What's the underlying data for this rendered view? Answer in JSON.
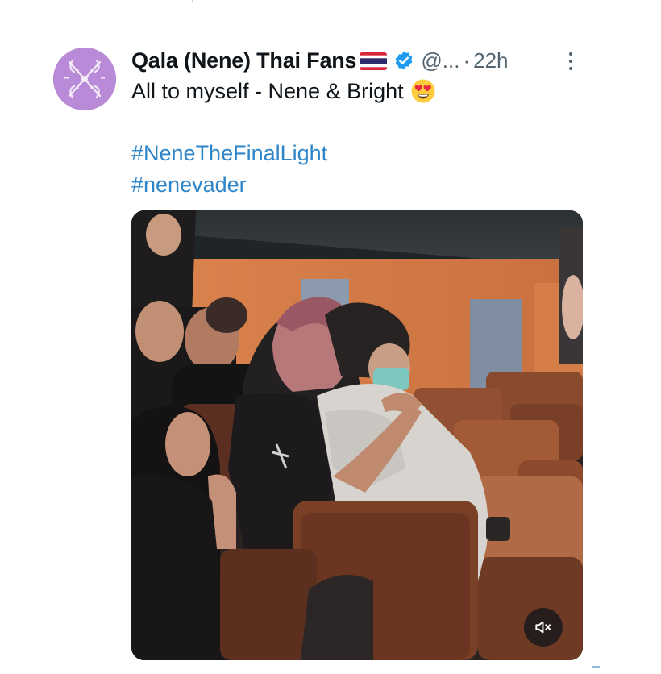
{
  "tweet": {
    "author": {
      "display_name": "Qala (Nene) Thai Fans",
      "flag": "thai-flag-icon",
      "verified": "verified-badge-icon",
      "handle": "@...",
      "separator": "·",
      "time": "22h"
    },
    "text": "All to myself - Nene & Bright",
    "emoji": "heart-eyes-emoji-icon",
    "hashtags": [
      "#NeneTheFinalLight",
      "#nenevader"
    ],
    "media": {
      "type": "video",
      "audio_control": "speaker-muted-icon"
    }
  },
  "colors": {
    "text": "#0f1419",
    "secondary_text": "#536471",
    "link": "#2e86c9",
    "verified": "#1d9bf0",
    "avatar_bg": "#b98ad7"
  }
}
